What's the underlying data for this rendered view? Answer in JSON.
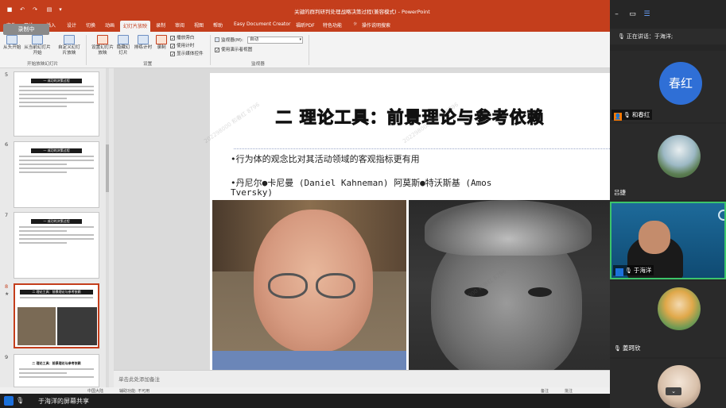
{
  "window": {
    "title": "关键的群判研判处理战略决策过程(兼容模式) - PowerPoint",
    "quick_access": [
      "save-icon",
      "undo-icon",
      "redo-icon",
      "customize-icon"
    ]
  },
  "ribbon_tabs": [
    "文件",
    "开始",
    "插入",
    "设计",
    "切换",
    "动画",
    "幻灯片放映",
    "录制",
    "审阅",
    "视图",
    "帮助",
    "Easy Document Creator",
    "福昕PDF",
    "特色功能",
    "操作说明搜索"
  ],
  "active_tab": "幻灯片放映",
  "ribbon": {
    "from_start": "从头开始",
    "from_current": "从当前幻灯片开始",
    "custom_show": "自定义幻灯片放映",
    "group_start": "开始放映幻灯片",
    "setup_show": "设置幻灯片放映",
    "hide_slide": "隐藏幻灯片",
    "rehearse": "排练计时",
    "record": "录制",
    "group_setup": "设置",
    "play_narration": "播放旁白",
    "use_timings": "使用计时",
    "show_media": "显示媒体控件",
    "monitor_label": "监视器(M):",
    "monitor_value": "自动",
    "presenter_view": "使用演示者视图",
    "group_monitor": "监视器"
  },
  "recording_badge": "录制中",
  "thumbnails": [
    {
      "num": "5",
      "heading": "一 成功的决策过程"
    },
    {
      "num": "6",
      "heading": "一 成功的决策过程"
    },
    {
      "num": "7",
      "heading": "一 成功的决策过程"
    },
    {
      "num": "8",
      "heading": "二 理论工具：前景理论与参考依赖"
    },
    {
      "num": "9",
      "heading": "二 理论工具：前景理论与参考依赖"
    }
  ],
  "slide": {
    "title": "二 理论工具：前景理论与参考依赖",
    "bullet1": "•行为体的观念比对其活动领域的客观指标更有用",
    "bullet2_line1": "•丹尼尔●卡尼曼 (Daniel Kahneman)  阿莫斯●特沃斯基 (Amos",
    "bullet2_line2": "Tversky)"
  },
  "notes_placeholder": "单击此处添加备注",
  "statusbar": {
    "lang": "中国大陆",
    "accessibility": "辅助功能: 不可用",
    "notes": "备注",
    "comments": "批注"
  },
  "meeting": {
    "speaking": "正在讲话：于海洋;",
    "participants": [
      {
        "name": "和春红",
        "avatar_text": "春红",
        "role": "host"
      },
      {
        "name": "吕捷",
        "avatar_text": ""
      },
      {
        "name": "于海洋",
        "avatar_text": "",
        "role": "cohost"
      },
      {
        "name": "姜珂欣",
        "avatar_text": ""
      }
    ]
  },
  "share_bar": {
    "label": "于海洋的屏幕共享"
  },
  "colors": {
    "ppt_red": "#c43e1c",
    "meeting_bg": "#262626",
    "avatar_blue": "#2f6fd6",
    "host_orange": "#ff7a00"
  }
}
